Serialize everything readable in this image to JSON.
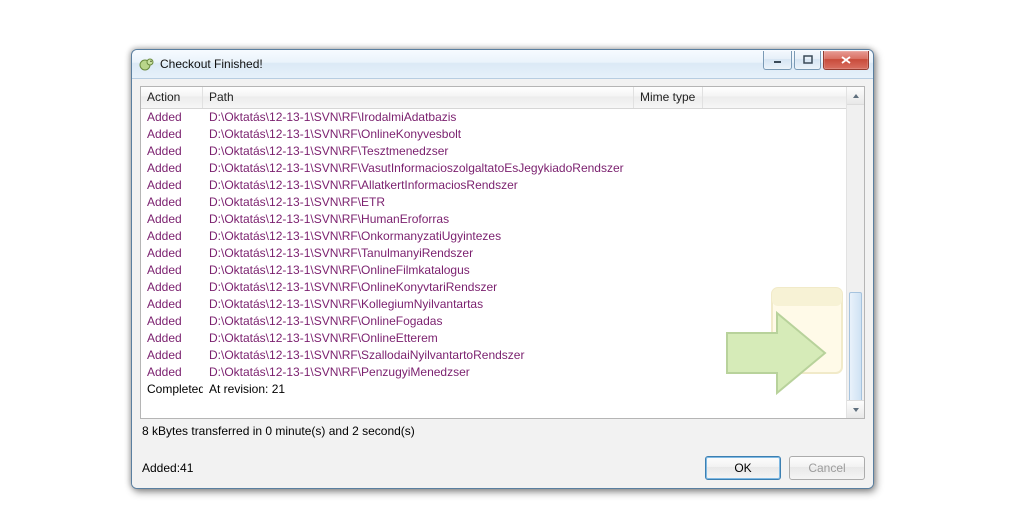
{
  "window": {
    "title": "Checkout Finished!"
  },
  "columns": {
    "action": "Action",
    "path": "Path",
    "mime": "Mime type"
  },
  "rows": [
    {
      "action": "Added",
      "path": "D:\\Oktatás\\12-13-1\\SVN\\RF\\IrodalmiAdatbazis"
    },
    {
      "action": "Added",
      "path": "D:\\Oktatás\\12-13-1\\SVN\\RF\\OnlineKonyvesbolt"
    },
    {
      "action": "Added",
      "path": "D:\\Oktatás\\12-13-1\\SVN\\RF\\Tesztmenedzser"
    },
    {
      "action": "Added",
      "path": "D:\\Oktatás\\12-13-1\\SVN\\RF\\VasutInformacioszolgaltatoEsJegykiadoRendszer"
    },
    {
      "action": "Added",
      "path": "D:\\Oktatás\\12-13-1\\SVN\\RF\\AllatkertInformaciosRendszer"
    },
    {
      "action": "Added",
      "path": "D:\\Oktatás\\12-13-1\\SVN\\RF\\ETR"
    },
    {
      "action": "Added",
      "path": "D:\\Oktatás\\12-13-1\\SVN\\RF\\HumanEroforras"
    },
    {
      "action": "Added",
      "path": "D:\\Oktatás\\12-13-1\\SVN\\RF\\OnkormanyzatiUgyintezes"
    },
    {
      "action": "Added",
      "path": "D:\\Oktatás\\12-13-1\\SVN\\RF\\TanulmanyiRendszer"
    },
    {
      "action": "Added",
      "path": "D:\\Oktatás\\12-13-1\\SVN\\RF\\OnlineFilmkatalogus"
    },
    {
      "action": "Added",
      "path": "D:\\Oktatás\\12-13-1\\SVN\\RF\\OnlineKonyvtariRendszer"
    },
    {
      "action": "Added",
      "path": "D:\\Oktatás\\12-13-1\\SVN\\RF\\KollegiumNyilvantartas"
    },
    {
      "action": "Added",
      "path": "D:\\Oktatás\\12-13-1\\SVN\\RF\\OnlineFogadas"
    },
    {
      "action": "Added",
      "path": "D:\\Oktatás\\12-13-1\\SVN\\RF\\OnlineEtterem"
    },
    {
      "action": "Added",
      "path": "D:\\Oktatás\\12-13-1\\SVN\\RF\\SzallodaiNyilvantartoRendszer"
    },
    {
      "action": "Added",
      "path": "D:\\Oktatás\\12-13-1\\SVN\\RF\\PenzugyiMenedzser"
    },
    {
      "action": "Completed",
      "path": "At revision: 21",
      "completed": true
    }
  ],
  "status": "8 kBytes transferred in 0 minute(s) and 2 second(s)",
  "summary": "Added:41",
  "buttons": {
    "ok": "OK",
    "cancel": "Cancel"
  }
}
